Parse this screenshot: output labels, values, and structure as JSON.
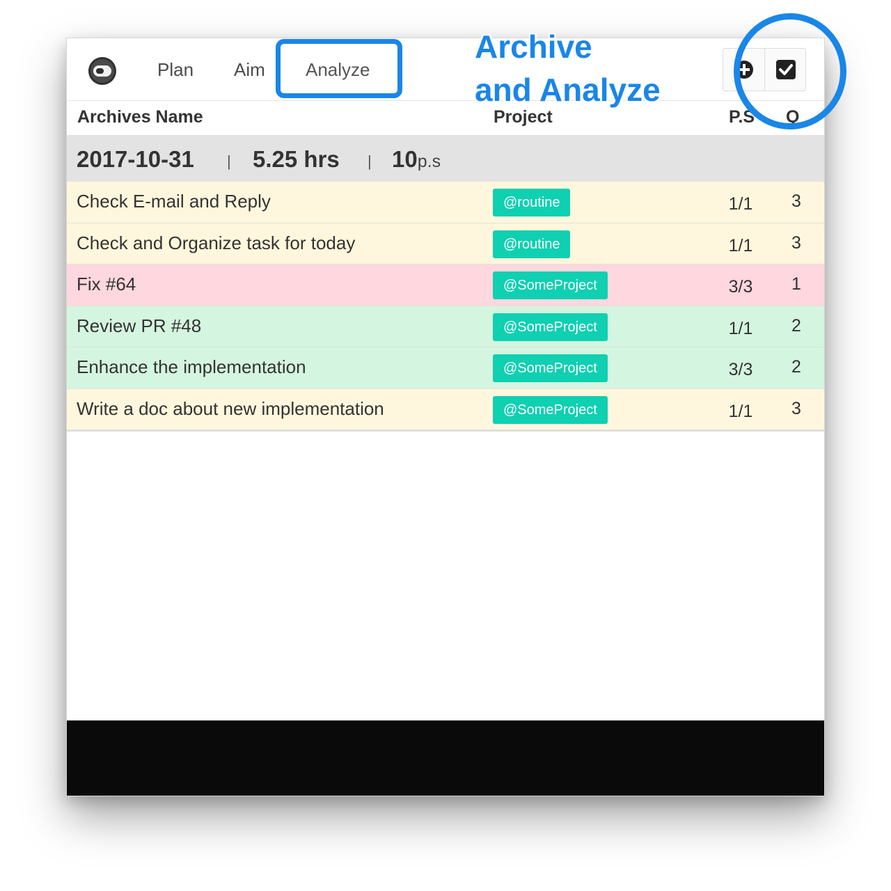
{
  "nav": {
    "tabs": [
      {
        "label": "Plan"
      },
      {
        "label": "Aim"
      },
      {
        "label": "Analyze"
      }
    ],
    "logo_icon": "toggle-pill-icon",
    "actions": [
      {
        "icon": "plus-circle-icon"
      },
      {
        "icon": "checkbox-checked-icon"
      }
    ]
  },
  "table": {
    "headers": {
      "name": "Archives Name",
      "project": "Project",
      "ps": "P.S",
      "q": "Q"
    },
    "summary": {
      "date": "2017-10-31",
      "separator": "|",
      "hours": "5.25 hrs",
      "ps_value": "10",
      "ps_unit": "p.s"
    },
    "rows": [
      {
        "name": "Check E-mail and Reply",
        "project": "@routine",
        "ps": "1/1",
        "q": "3",
        "color": "#fff7dd"
      },
      {
        "name": "Check and Organize task for today",
        "project": "@routine",
        "ps": "1/1",
        "q": "3",
        "color": "#fff7dd"
      },
      {
        "name": "Fix #64",
        "project": "@SomeProject",
        "ps": "3/3",
        "q": "1",
        "color": "#ffd7de"
      },
      {
        "name": "Review PR #48",
        "project": "@SomeProject",
        "ps": "1/1",
        "q": "2",
        "color": "#d4f5df"
      },
      {
        "name": "Enhance the implementation",
        "project": "@SomeProject",
        "ps": "3/3",
        "q": "2",
        "color": "#d4f5df"
      },
      {
        "name": "Write a doc about new implementation",
        "project": "@SomeProject",
        "ps": "1/1",
        "q": "3",
        "color": "#fff7dd"
      }
    ]
  },
  "annotation": {
    "line1": "Archive",
    "line2": "and Analyze",
    "color": "#1a86e8"
  },
  "colors": {
    "tag": "#0fd0b1",
    "summary_bg": "#e3e3e3",
    "footer": "#0a0a0a"
  }
}
